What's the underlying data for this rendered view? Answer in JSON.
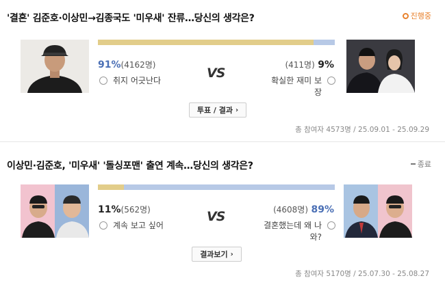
{
  "polls": [
    {
      "title": "'결혼' 김준호·이상민→김종국도 '미우새' 잔류…당신의 생각은?",
      "status": "진행중",
      "left": {
        "percent": "91%",
        "count": "(4162명)",
        "option": "취지 어긋난다"
      },
      "right": {
        "percent": "9%",
        "count": "(411명)",
        "option": "확실한 재미 보장"
      },
      "vs": "VS",
      "button": "투표 / 결과",
      "meta": "총 참여자 4573명 / 25.09.01 - 25.09.29",
      "colors": {
        "bar_left": "#e2cd8a",
        "bar_right": "#b7c9e6",
        "pct_left": "#4a6fb5",
        "pct_right": "#222222"
      }
    },
    {
      "title": "이상민·김준호, '미우새' '돌싱포맨' 출연 계속…당신의 생각은?",
      "status": "종료",
      "left": {
        "percent": "11%",
        "count": "(562명)",
        "option": "계속 보고 싶어"
      },
      "right": {
        "percent": "89%",
        "count": "(4608명)",
        "option": "결혼했는데 왜 나와?"
      },
      "vs": "VS",
      "button": "결과보기",
      "meta": "총 참여자 5170명 / 25.07.30 - 25.08.27",
      "colors": {
        "bar_left": "#e2cd8a",
        "bar_right": "#b7c9e6",
        "pct_left": "#222222",
        "pct_right": "#4a6fb5"
      }
    }
  ]
}
